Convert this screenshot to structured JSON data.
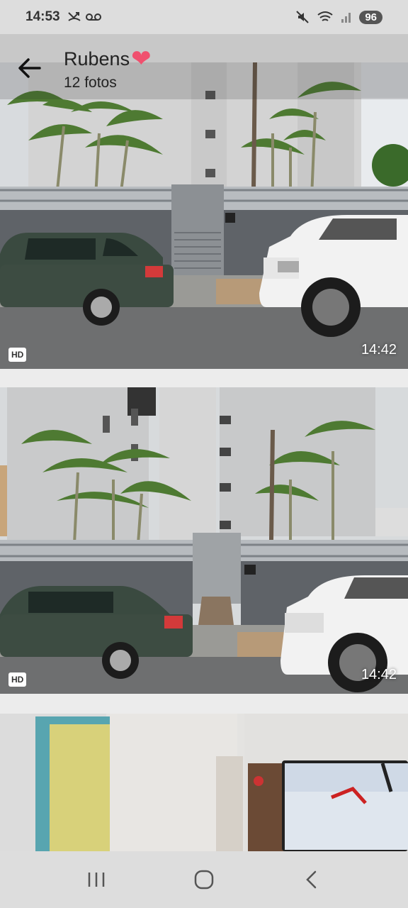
{
  "status_bar": {
    "time": "14:53",
    "battery": "96",
    "icons": [
      "missed-call-icon",
      "voicemail-icon",
      "mute-icon",
      "wifi-icon",
      "signal-icon"
    ]
  },
  "header": {
    "title": "Rubens",
    "title_emoji": "❤",
    "subtitle": "12 fotos"
  },
  "photos": [
    {
      "badge": "HD",
      "timestamp": "14:42"
    },
    {
      "badge": "HD",
      "timestamp": "14:42"
    },
    {
      "badge": "",
      "timestamp": ""
    }
  ],
  "nav": {
    "icons": [
      "recent-apps-icon",
      "home-icon",
      "back-icon"
    ]
  },
  "colors": {
    "heart": "#f0506e",
    "status_bg": "#dddddd",
    "nav_bg": "#dddddd"
  }
}
